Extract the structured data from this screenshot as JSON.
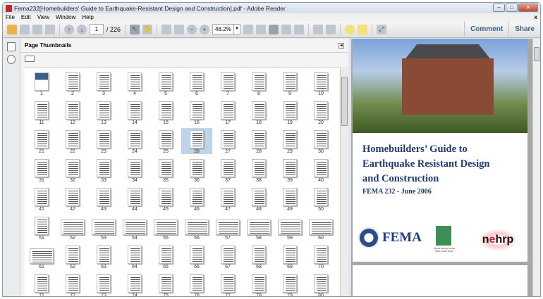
{
  "window": {
    "title": "Fema232[Homebuilders' Guide to Earthquake-Resistant Design and Construction].pdf - Adobe Reader",
    "minimize": "–",
    "maximize": "□",
    "close": "✕"
  },
  "menu": [
    "File",
    "Edit",
    "View",
    "Window",
    "Help"
  ],
  "menu_close": "x",
  "toolbar": {
    "page_current": "1",
    "page_total": "/ 226",
    "zoom": "48.2%",
    "comment": "Comment",
    "share": "Share"
  },
  "panel": {
    "title": "Page Thumbnails",
    "selected_page": 26,
    "landscape_pages": [
      52,
      53,
      54,
      55,
      56,
      57,
      58,
      59,
      60,
      61
    ]
  },
  "document": {
    "title_lines": [
      "Homebuilders’ Guide to",
      "Earthquake Resistant Design",
      "and Construction"
    ],
    "subtitle": "FEMA 232 - June 2006",
    "logos": {
      "fema": "FEMA",
      "icc_caption": "People Helping People Build a Safer World",
      "nehrp_pre": "n",
      "nehrp_e": "e",
      "nehrp_post": "hrp"
    }
  },
  "colors": {
    "title": "#1e3a6e",
    "selection": "#bcd5ea"
  }
}
